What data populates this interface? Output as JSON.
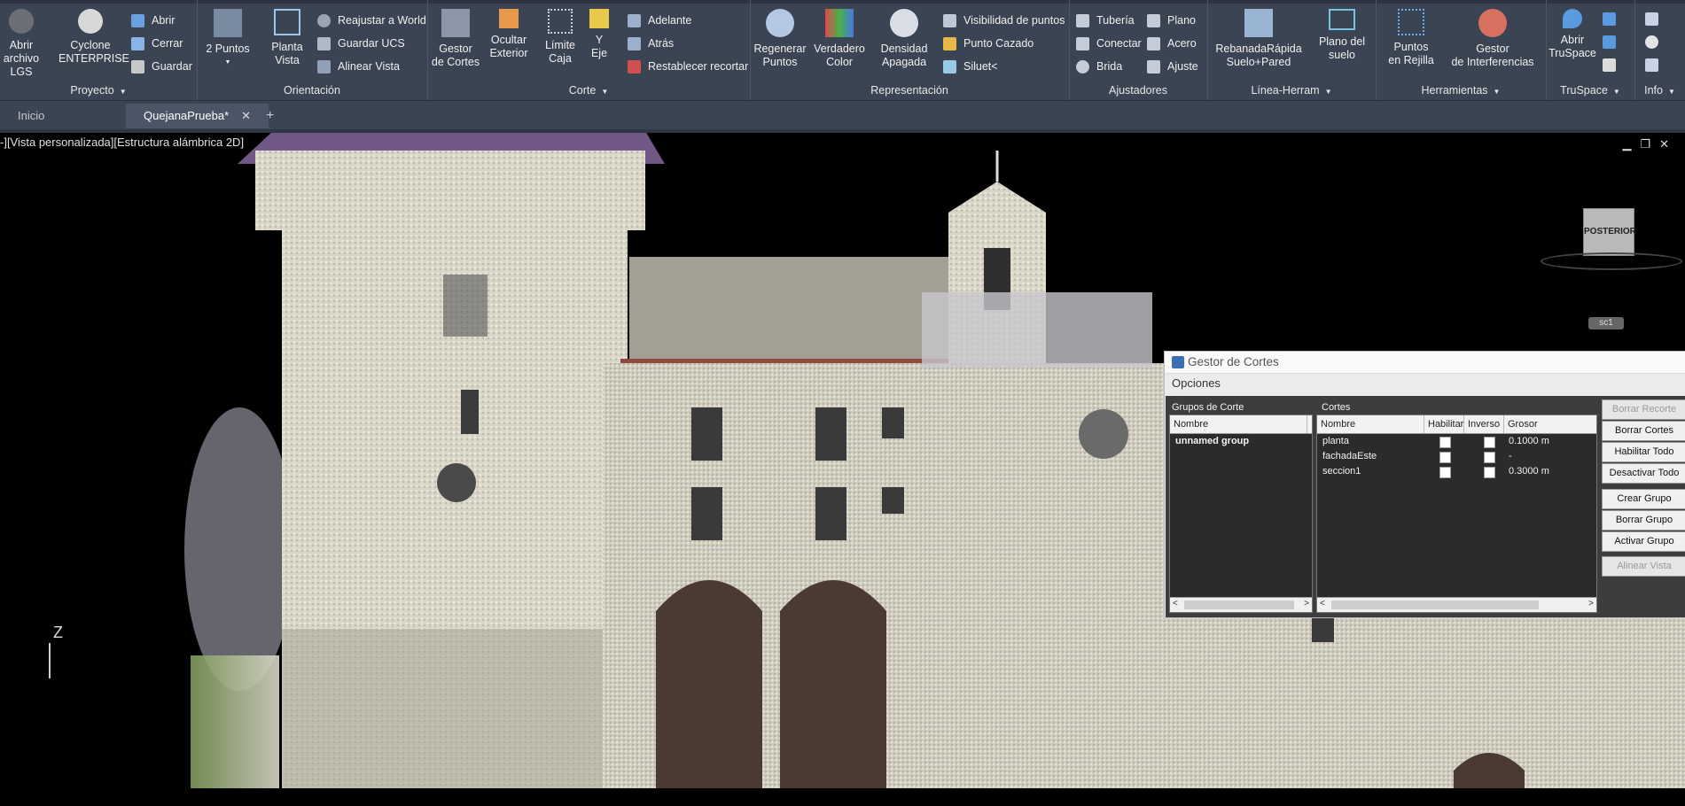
{
  "ribbon": {
    "panels": {
      "proyecto": "Proyecto",
      "orientacion": "Orientación",
      "corte": "Corte",
      "representacion": "Representación",
      "ajustadores": "Ajustadores",
      "linea": "Línea-Herram",
      "herramientas": "Herramientas",
      "truspace": "TruSpace",
      "info": "Info"
    },
    "abrir_lgs": [
      "Abrir",
      "archivo LGS"
    ],
    "cyclone": [
      "Cyclone",
      "ENTERPRISE"
    ],
    "abrir": "Abrir",
    "cerrar": "Cerrar",
    "guardar": "Guardar",
    "dos_puntos": "2 Puntos",
    "planta_vista": [
      "Planta",
      "Vista"
    ],
    "reajustar": "Reajustar a World",
    "guardar_ucs": "Guardar UCS",
    "alinear_vista": "Alinear Vista",
    "gestor_cortes": [
      "Gestor",
      "de Cortes"
    ],
    "ocultar": [
      "Ocultar",
      "Exterior"
    ],
    "limite": [
      "Límite",
      "Caja"
    ],
    "y_eje": [
      "Y",
      "Eje"
    ],
    "adelante": "Adelante",
    "atras": "Atrás",
    "restablecer": "Restablecer recortar",
    "regenerar": [
      "Regenerar",
      "Puntos"
    ],
    "verdadero": [
      "Verdadero",
      "Color"
    ],
    "densidad": [
      "Densidad",
      "Apagada"
    ],
    "visibilidad": "Visibilidad de puntos",
    "punto_cazado": "Punto Cazado",
    "siluet": "Siluet<",
    "tuberia": "Tubería",
    "plano": "Plano",
    "conectar": "Conectar",
    "acero": "Acero",
    "brida": "Brida",
    "ajuste": "Ajuste",
    "rebanada": [
      "RebanadaRápida",
      "Suelo+Pared"
    ],
    "plano_suelo": [
      "Plano del",
      "suelo"
    ],
    "puntos_rejilla": [
      "Puntos",
      "en Rejilla"
    ],
    "gestor_interf": [
      "Gestor",
      "de Interferencias"
    ],
    "abrir_truspace": [
      "Abrir",
      "TruSpace"
    ]
  },
  "tabs": [
    "Inicio",
    "QuejanaPrueba*"
  ],
  "viewport": {
    "label": "-][Vista personalizada][Estructura alámbrica 2D]",
    "navcube": "POSTERIOR",
    "ucs_label": "sc1",
    "z_axis": "Z"
  },
  "gestor": {
    "title": "Gestor de Cortes",
    "opciones": "Opciones",
    "grupos_label": "Grupos de Corte",
    "cortes_label": "Cortes",
    "grupos_header": "Nombre",
    "grupos": [
      "unnamed group"
    ],
    "cortes_headers": [
      "Nombre",
      "Habilitar",
      "Inverso",
      "Grosor"
    ],
    "cortes": [
      {
        "nombre": "planta",
        "grosor": "0.1000 m"
      },
      {
        "nombre": "fachadaEste",
        "grosor": "-"
      },
      {
        "nombre": "seccion1",
        "grosor": "0.3000 m"
      }
    ],
    "buttons": [
      "Borrar Recorte",
      "Borrar Cortes",
      "Habilitar Todo",
      "Desactivar Todo",
      "Crear Grupo",
      "Borrar Grupo",
      "Activar Grupo",
      "Alinear Vista"
    ]
  },
  "colors": {
    "ribbon": "#3b4453",
    "panel_bg": "#3d3d3d",
    "accent": "#3c6fb0"
  }
}
